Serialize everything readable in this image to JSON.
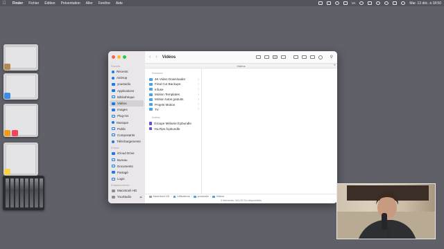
{
  "menubar": {
    "items": [
      "Finder",
      "Fichier",
      "Édition",
      "Présentation",
      "Aller",
      "Fenêtre",
      "Aide"
    ],
    "keyboard_indicator": "VA",
    "datetime": "Mar. 13 déc. à 18:50"
  },
  "finder": {
    "title": "Vidéos",
    "tab_label": "Vidéos",
    "sidebar": {
      "favorites_header": "Favoris",
      "favorites": [
        "Récents",
        "AirDrop",
        "youstudio",
        "Applications",
        "Bibliothèque",
        "Vidéos",
        "Images",
        "Plug-ins",
        "Musique",
        "Public",
        "Composants",
        "Téléchargements"
      ],
      "selected": "Vidéos",
      "icloud_header": "iCloud",
      "icloud": [
        "iCloud Drive",
        "Bureau",
        "Documents",
        "Partagé",
        "Logic"
      ],
      "locations_header": "Emplacements",
      "locations": [
        "Macintosh HD",
        "YouStudio"
      ]
    },
    "column": {
      "folders_header": "Dossiers",
      "folders": [
        "4K Video Downloader",
        "Final Cut Backups",
        "Infuse",
        "Motion Templates",
        "Motion tutos gratuits",
        "Projets Motion",
        "TV"
      ],
      "others_header": "Autres",
      "others": [
        "Groupe Mélanie.fcpbundle",
        "YouTips.fcpbundle"
      ]
    },
    "path": [
      "Macintosh HD",
      "Utilisateurs",
      "youstudio",
      "Vidéos"
    ],
    "status": "9 éléments, 441,52 Go disponibles"
  },
  "colors": {
    "desktop": "#5f6068",
    "menubar": "#54555c",
    "accent": "#1a7ae8",
    "folder": "#4aa3e8",
    "bundle": "#6b4bd8"
  }
}
